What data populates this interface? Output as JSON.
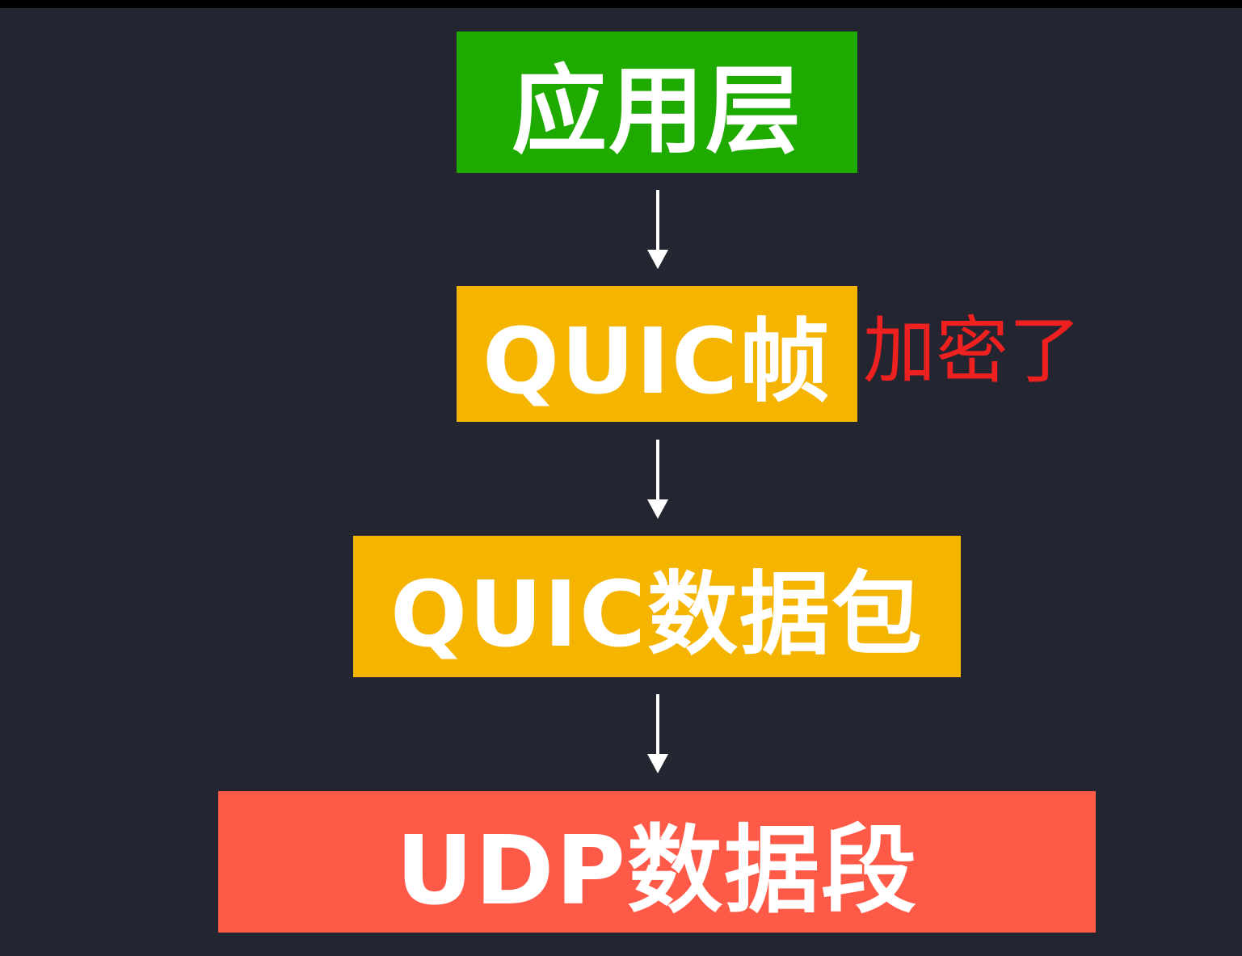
{
  "layers": [
    {
      "id": "app",
      "label": "应用层",
      "color": "#1faa00"
    },
    {
      "id": "frame",
      "label": "QUIC帧",
      "color": "#f5b400"
    },
    {
      "id": "packet",
      "label": "QUIC数据包",
      "color": "#f5b400"
    },
    {
      "id": "udp",
      "label": "UDP数据段",
      "color": "#ff5a47"
    }
  ],
  "annotation": {
    "text": "加密了",
    "color": "#ee2020"
  },
  "arrow_color": "#ffffff",
  "background": "#232530"
}
